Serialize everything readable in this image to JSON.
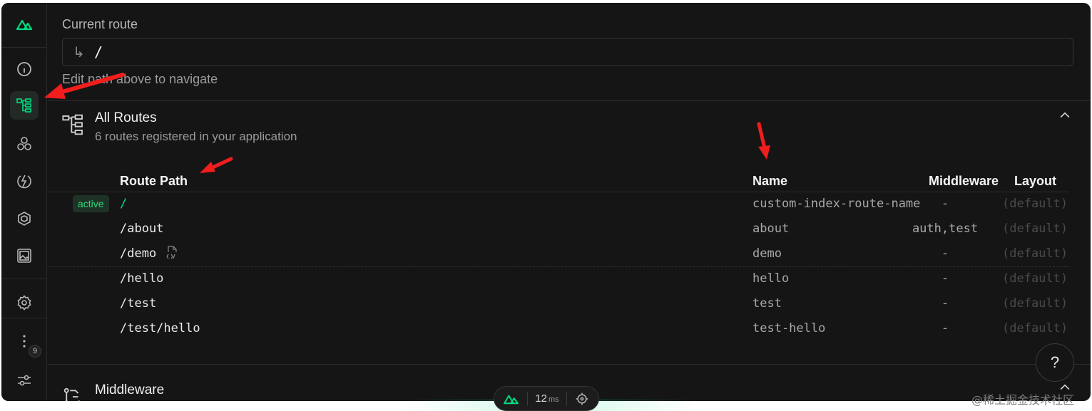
{
  "sidebar": {
    "icons": [
      "nuxt-logo-icon",
      "info-icon",
      "routes-tree-icon",
      "components-icon",
      "plugins-icon",
      "modules-icon",
      "assets-image-icon",
      "settings-gear-icon",
      "more-vertical-icon",
      "sliders-icon"
    ],
    "more_badge": "9",
    "accent": "#00dc82"
  },
  "current_route": {
    "label": "Current route",
    "value": "/",
    "arrow_glyph": "↳",
    "hint": "Edit path above to navigate"
  },
  "routes_section": {
    "title": "All Routes",
    "subtitle": "6 routes registered in your application",
    "columns": [
      "Route Path",
      "Name",
      "Middleware",
      "Layout"
    ],
    "active_badge": "active",
    "rows": [
      {
        "path": "/",
        "name": "custom-index-route-name",
        "middleware": "-",
        "layout": "(default)",
        "active": true
      },
      {
        "path": "/about",
        "name": "about",
        "middleware": "auth,test",
        "layout": "(default)"
      },
      {
        "path": "/demo",
        "name": "demo",
        "middleware": "-",
        "layout": "(default)",
        "has_file_icon": true
      },
      {
        "path": "/hello",
        "name": "hello",
        "middleware": "-",
        "layout": "(default)"
      },
      {
        "path": "/test",
        "name": "test",
        "middleware": "-",
        "layout": "(default)"
      },
      {
        "path": "/test/hello",
        "name": "test-hello",
        "middleware": "-",
        "layout": "(default)"
      }
    ]
  },
  "middleware_section": {
    "title": "Middleware"
  },
  "help_button": "?",
  "bottom_bar": {
    "time_value": "12",
    "time_unit": "ms"
  },
  "watermark": "@稀土掘金技术社区"
}
